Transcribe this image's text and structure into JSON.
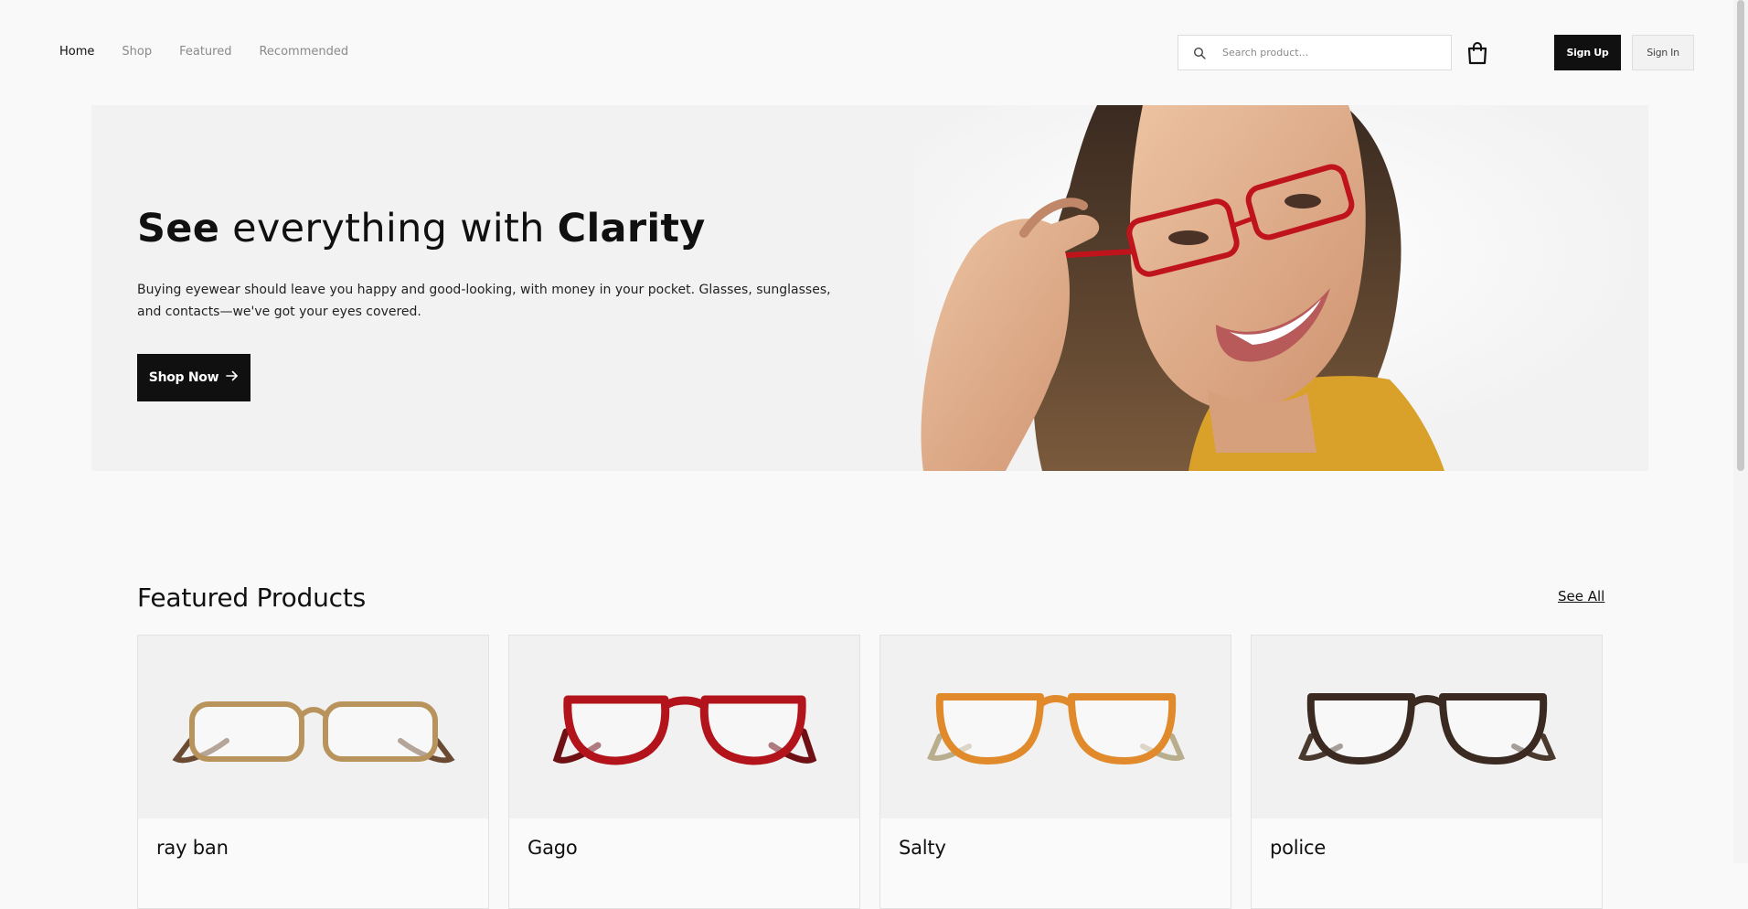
{
  "nav": {
    "items": [
      {
        "label": "Home",
        "active": true
      },
      {
        "label": "Shop",
        "active": false
      },
      {
        "label": "Featured",
        "active": false
      },
      {
        "label": "Recommended",
        "active": false
      }
    ]
  },
  "header": {
    "search_placeholder": "Search product...",
    "search_value": "",
    "cart_icon": "shopping-bag-icon",
    "signup_label": "Sign Up",
    "signin_label": "Sign In"
  },
  "hero": {
    "title_bold_1": "See",
    "title_middle": " everything with ",
    "title_bold_2": "Clarity",
    "description": "Buying eyewear should leave you happy and good-looking, with money in your pocket. Glasses, sunglasses, and contacts—we've got your eyes covered.",
    "cta_label": "Shop Now",
    "cta_icon": "arrow-right-icon"
  },
  "featured": {
    "title": "Featured Products",
    "see_all_label": "See All",
    "products": [
      {
        "name": "ray ban",
        "frame_color": "#b8935c",
        "temple_color": "#6a4a32"
      },
      {
        "name": "Gago",
        "frame_color": "#b3141c",
        "temple_color": "#6e1014"
      },
      {
        "name": "Salty",
        "frame_color": "#e08a2c",
        "temple_color": "#b8ad8c"
      },
      {
        "name": "police",
        "frame_color": "#3a2a22",
        "temple_color": "#4a3a2e"
      }
    ]
  },
  "colors": {
    "accent": "#101010",
    "background": "#f9f9f9",
    "hero_background": "#f2f2f2",
    "muted_text": "#8a8a8a"
  }
}
